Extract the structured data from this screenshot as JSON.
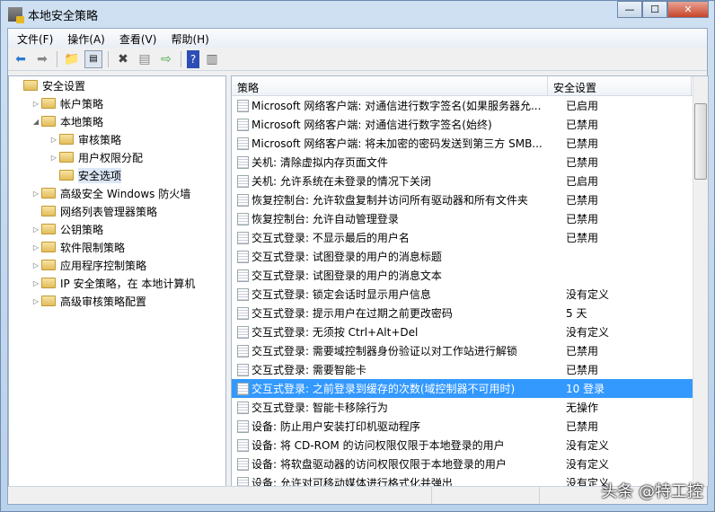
{
  "window": {
    "title": "本地安全策略"
  },
  "menu": [
    "文件(F)",
    "操作(A)",
    "查看(V)",
    "帮助(H)"
  ],
  "toolbar": [
    "back-icon",
    "forward-icon",
    "up-folder-icon",
    "show-hide-tree-icon",
    "delete-icon",
    "properties-icon",
    "export-icon",
    "help-icon",
    "action-pane-icon"
  ],
  "tree": [
    {
      "label": "安全设置",
      "level": 0,
      "exp": ""
    },
    {
      "label": "帐户策略",
      "level": 1,
      "exp": "▷"
    },
    {
      "label": "本地策略",
      "level": 1,
      "exp": "◢"
    },
    {
      "label": "审核策略",
      "level": 2,
      "exp": "▷"
    },
    {
      "label": "用户权限分配",
      "level": 2,
      "exp": "▷"
    },
    {
      "label": "安全选项",
      "level": 2,
      "exp": "",
      "selected": true
    },
    {
      "label": "高级安全 Windows 防火墙",
      "level": 1,
      "exp": "▷"
    },
    {
      "label": "网络列表管理器策略",
      "level": 1,
      "exp": ""
    },
    {
      "label": "公钥策略",
      "level": 1,
      "exp": "▷"
    },
    {
      "label": "软件限制策略",
      "level": 1,
      "exp": "▷"
    },
    {
      "label": "应用程序控制策略",
      "level": 1,
      "exp": "▷"
    },
    {
      "label": "IP 安全策略，在 本地计算机",
      "level": 1,
      "exp": "▷"
    },
    {
      "label": "高级审核策略配置",
      "level": 1,
      "exp": "▷"
    }
  ],
  "columns": {
    "policy": "策略",
    "setting": "安全设置"
  },
  "rows": [
    [
      "Microsoft 网络客户端: 对通信进行数字签名(如果服务器允...",
      "已启用"
    ],
    [
      "Microsoft 网络客户端: 对通信进行数字签名(始终)",
      "已禁用"
    ],
    [
      "Microsoft 网络客户端: 将未加密的密码发送到第三方 SMB...",
      "已禁用"
    ],
    [
      "关机: 清除虚拟内存页面文件",
      "已禁用"
    ],
    [
      "关机: 允许系统在未登录的情况下关闭",
      "已启用"
    ],
    [
      "恢复控制台: 允许软盘复制并访问所有驱动器和所有文件夹",
      "已禁用"
    ],
    [
      "恢复控制台: 允许自动管理登录",
      "已禁用"
    ],
    [
      "交互式登录: 不显示最后的用户名",
      "已禁用"
    ],
    [
      "交互式登录: 试图登录的用户的消息标题",
      ""
    ],
    [
      "交互式登录: 试图登录的用户的消息文本",
      ""
    ],
    [
      "交互式登录: 锁定会话时显示用户信息",
      "没有定义"
    ],
    [
      "交互式登录: 提示用户在过期之前更改密码",
      "5 天"
    ],
    [
      "交互式登录: 无须按 Ctrl+Alt+Del",
      "没有定义"
    ],
    [
      "交互式登录: 需要域控制器身份验证以对工作站进行解锁",
      "已禁用"
    ],
    [
      "交互式登录: 需要智能卡",
      "已禁用"
    ],
    [
      "交互式登录: 之前登录到缓存的次数(域控制器不可用时)",
      "10 登录"
    ],
    [
      "交互式登录: 智能卡移除行为",
      "无操作"
    ],
    [
      "设备: 防止用户安装打印机驱动程序",
      "已禁用"
    ],
    [
      "设备: 将 CD-ROM 的访问权限仅限于本地登录的用户",
      "没有定义"
    ],
    [
      "设备: 将软盘驱动器的访问权限仅限于本地登录的用户",
      "没有定义"
    ],
    [
      "设备: 允许对可移动媒体进行格式化并弹出",
      "没有定义"
    ]
  ],
  "selected_row": 15,
  "watermark": "头条 @特工控"
}
